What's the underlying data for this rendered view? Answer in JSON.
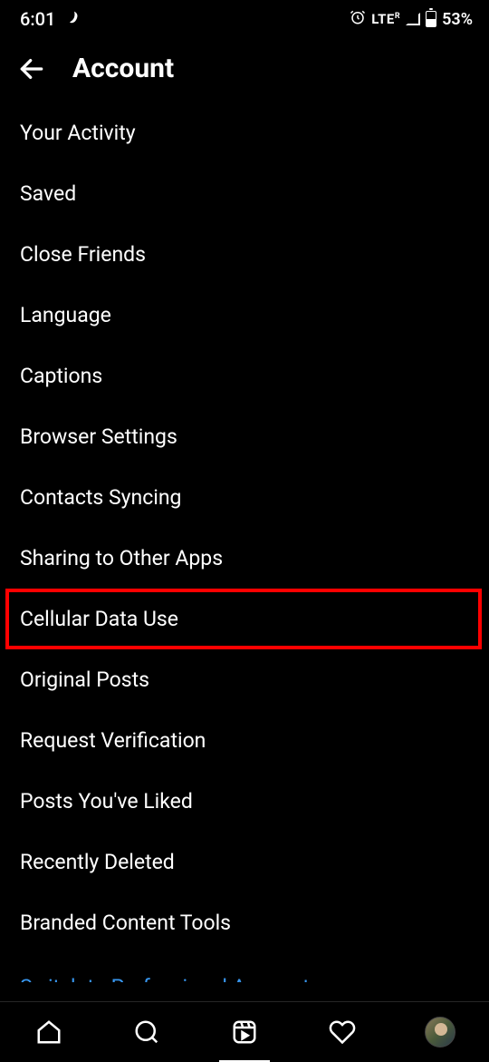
{
  "status": {
    "time": "6:01",
    "network": "LTE",
    "network_sup": "R",
    "battery": "53%"
  },
  "header": {
    "title": "Account"
  },
  "menu": {
    "items": [
      {
        "label": "Your Activity",
        "highlighted": false
      },
      {
        "label": "Saved",
        "highlighted": false
      },
      {
        "label": "Close Friends",
        "highlighted": false
      },
      {
        "label": "Language",
        "highlighted": false
      },
      {
        "label": "Captions",
        "highlighted": false
      },
      {
        "label": "Browser Settings",
        "highlighted": false
      },
      {
        "label": "Contacts Syncing",
        "highlighted": false
      },
      {
        "label": "Sharing to Other Apps",
        "highlighted": false
      },
      {
        "label": "Cellular Data Use",
        "highlighted": true
      },
      {
        "label": "Original Posts",
        "highlighted": false
      },
      {
        "label": "Request Verification",
        "highlighted": false
      },
      {
        "label": "Posts You've Liked",
        "highlighted": false
      },
      {
        "label": "Recently Deleted",
        "highlighted": false
      },
      {
        "label": "Branded Content Tools",
        "highlighted": false
      }
    ],
    "cutoff_item": "Switch to Professional Account"
  }
}
